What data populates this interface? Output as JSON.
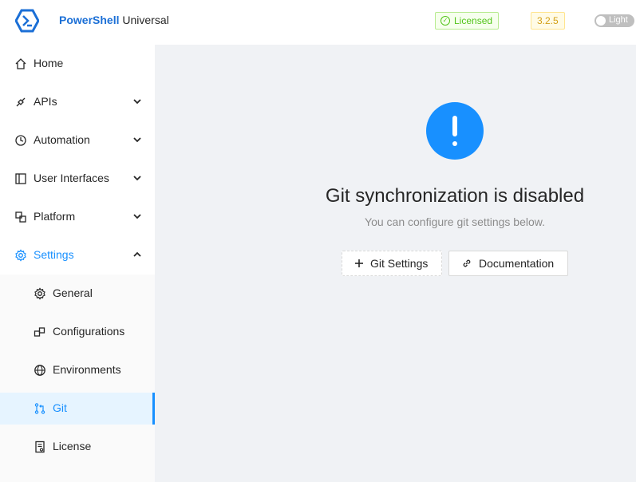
{
  "header": {
    "brand_bold": "PowerShell",
    "brand_rest": " Universal",
    "license_label": "Licensed",
    "version": "3.2.5",
    "theme_label": "Light"
  },
  "sidebar": {
    "items": [
      {
        "label": "Home",
        "icon": "home-icon"
      },
      {
        "label": "APIs",
        "icon": "api-icon"
      },
      {
        "label": "Automation",
        "icon": "clock-icon"
      },
      {
        "label": "User Interfaces",
        "icon": "layout-icon"
      },
      {
        "label": "Platform",
        "icon": "platform-icon"
      },
      {
        "label": "Settings",
        "icon": "gear-icon"
      }
    ],
    "sub_items": [
      {
        "label": "General",
        "icon": "gear-icon"
      },
      {
        "label": "Configurations",
        "icon": "blocks-icon"
      },
      {
        "label": "Environments",
        "icon": "globe-icon"
      },
      {
        "label": "Git",
        "icon": "git-pull-icon"
      },
      {
        "label": "License",
        "icon": "license-icon"
      }
    ]
  },
  "main": {
    "title": "Git synchronization is disabled",
    "subtitle": "You can configure git settings below.",
    "git_settings_button": "Git Settings",
    "documentation_button": "Documentation"
  },
  "colors": {
    "accent": "#1890ff",
    "success": "#52c41a",
    "warning": "#d4a017"
  }
}
